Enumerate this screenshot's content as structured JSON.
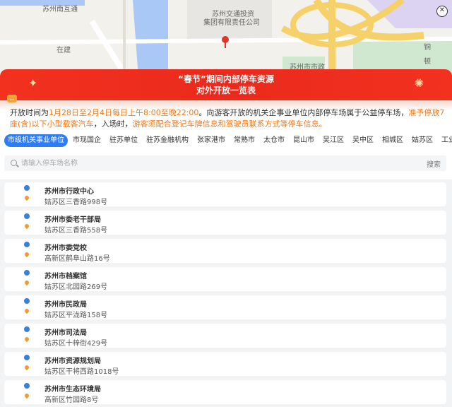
{
  "map": {
    "labels": [
      "苏州南互通",
      "苏州交通投资",
      "集团有限责任公司",
      "在建",
      "苏州市市政",
      "铜",
      "顿"
    ],
    "close_symbol": "✕"
  },
  "banner": {
    "title": "“春节”期间内部停车资源",
    "subtitle": "对外开放一览表"
  },
  "notice": {
    "icon_label": "...",
    "part1": "开放时间为",
    "time": "1月28日至2月4日每日上午8:00至晚22:00",
    "part2": "。向游客开放的机关企事业单位内部停车场属于公益停车场，",
    "allowed": "准予停放7座(含)以下小型载客汽车",
    "part3": "，入场时，",
    "instruction": "游客须配合登记车牌信息和驾驶员联系方式等停车信息。"
  },
  "tabs": [
    "市级机关事业单位",
    "市现国企",
    "驻苏单位",
    "驻苏金融机构",
    "张家港市",
    "常熟市",
    "太仓市",
    "昆山市",
    "吴江区",
    "吴中区",
    "相城区",
    "姑苏区",
    "工业园区"
  ],
  "active_tab": 0,
  "search": {
    "placeholder": "请输入停车场名称",
    "button": "搜索"
  },
  "list": [
    {
      "name": "苏州市行政中心",
      "address": "姑苏区三香路998号"
    },
    {
      "name": "苏州市委老干部局",
      "address": "姑苏区三香路558号"
    },
    {
      "name": "苏州市委党校",
      "address": "高新区鹤阜山路16号"
    },
    {
      "name": "苏州市档案馆",
      "address": "姑苏区北园路269号"
    },
    {
      "name": "苏州市民政局",
      "address": "姑苏区平泷路158号"
    },
    {
      "name": "苏州市司法局",
      "address": "姑苏区十梓街429号"
    },
    {
      "name": "苏州市资源规划局",
      "address": "姑苏区干将西路1018号"
    },
    {
      "name": "苏州市生态环境局",
      "address": "高新区竹园路8号"
    }
  ],
  "colors": {
    "banner": "#ea2a1c",
    "accent": "#2f7df6",
    "highlight": "#f07a1a"
  }
}
